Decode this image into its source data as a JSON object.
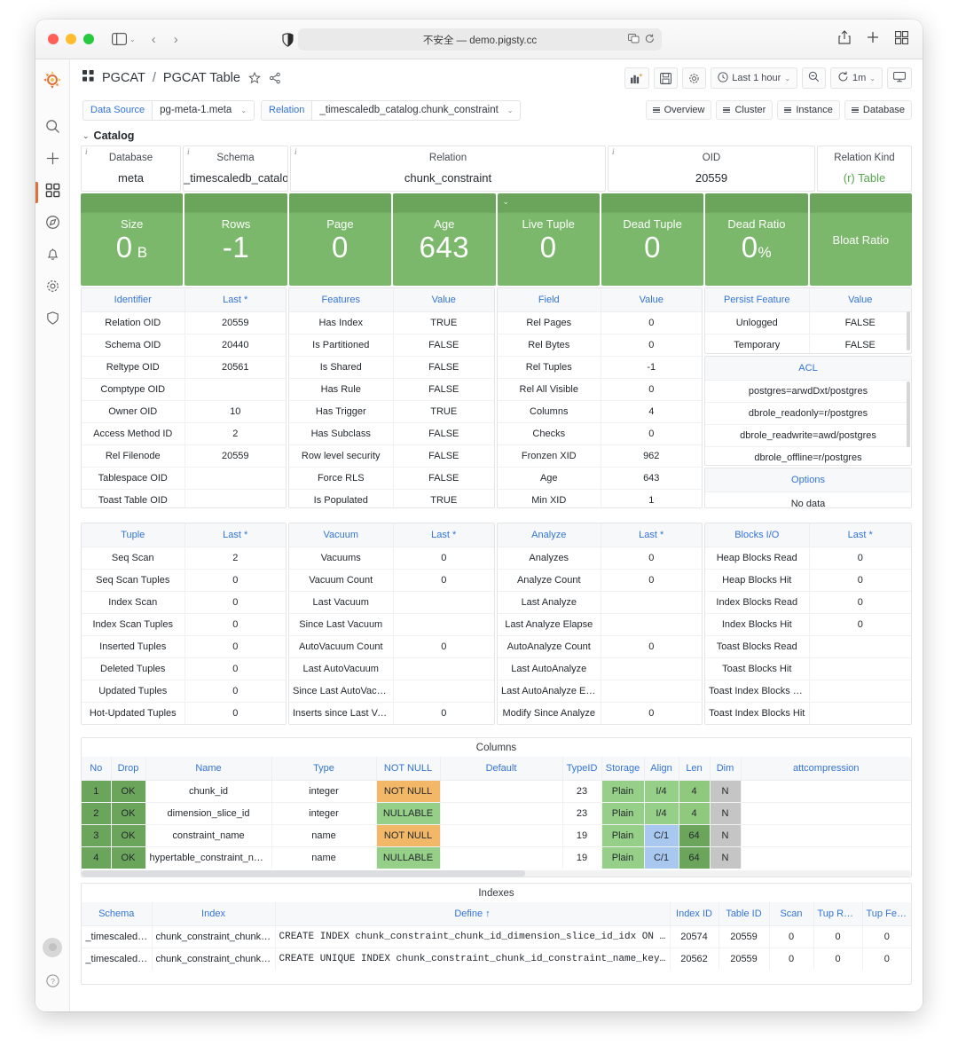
{
  "browser": {
    "url": "不安全 — demo.pigsty.cc",
    "icons": {
      "sidebar": "sidebar-toggle-icon",
      "back": "back-arrow-icon",
      "forward": "forward-arrow-icon",
      "shield": "privacy-shield-icon",
      "translate": "translate-icon",
      "reload": "reload-icon",
      "share": "share-icon",
      "newtab": "new-tab-icon",
      "tabgrid": "tab-overview-icon"
    }
  },
  "sidebar": {
    "logo": "grafana-logo-icon",
    "items": [
      {
        "name": "search",
        "icon": "search-icon",
        "active": false
      },
      {
        "name": "create",
        "icon": "plus-icon",
        "active": false
      },
      {
        "name": "dashboards",
        "icon": "grid-icon",
        "active": true
      },
      {
        "name": "explore",
        "icon": "compass-icon",
        "active": false
      },
      {
        "name": "alerting",
        "icon": "bell-icon",
        "active": false
      },
      {
        "name": "configuration",
        "icon": "gear-icon",
        "active": false
      },
      {
        "name": "server-admin",
        "icon": "shield-icon",
        "active": false
      }
    ],
    "bottom": [
      {
        "name": "user-profile",
        "icon": "avatar-icon"
      },
      {
        "name": "help",
        "icon": "question-circle-icon"
      }
    ]
  },
  "dashnav": {
    "grid_icon": "dashboard-grid-icon",
    "folder": "PGCAT",
    "separator": "/",
    "title": "PGCAT Table",
    "star_icon": "star-icon",
    "share_icon": "share-icon",
    "buttons": [
      {
        "name": "add-panel",
        "icon": "add-panel-icon",
        "label": ""
      },
      {
        "name": "save-dashboard",
        "icon": "save-icon",
        "label": ""
      },
      {
        "name": "dashboard-settings",
        "icon": "gear-icon",
        "label": ""
      }
    ],
    "time_picker": {
      "icon": "clock-icon",
      "label": "Last 1 hour",
      "caret": "⌄"
    },
    "zoom_out": {
      "icon": "zoom-out-icon"
    },
    "refresh": {
      "icon": "refresh-icon",
      "interval": "1m",
      "caret": "⌄"
    },
    "tv_mode": {
      "icon": "tv-icon"
    }
  },
  "variables": [
    {
      "label": "Data Source",
      "value": "pg-meta-1.meta",
      "caret": "⌄"
    },
    {
      "label": "Relation",
      "value": "_timescaledb_catalog.chunk_constraint",
      "caret": "⌄"
    }
  ],
  "links": [
    {
      "label": "Overview"
    },
    {
      "label": "Cluster"
    },
    {
      "label": "Instance"
    },
    {
      "label": "Database"
    }
  ],
  "row": {
    "chevron": "⌄",
    "title": "Catalog"
  },
  "info_stats": [
    {
      "title": "Database",
      "value": "meta",
      "info": "i",
      "green": false
    },
    {
      "title": "Schema",
      "value": "_timescaledb_catalog",
      "info": "i",
      "green": false
    },
    {
      "title": "Relation",
      "value": "chunk_constraint",
      "info": "i",
      "green": false
    },
    {
      "title": "OID",
      "value": "20559",
      "info": "i",
      "green": false
    },
    {
      "title": "Relation Kind",
      "value": "(r) Table",
      "info": "",
      "green": true
    }
  ],
  "big_stats": [
    {
      "title": "Size",
      "value": "0",
      "unit": " B"
    },
    {
      "title": "Rows",
      "value": "-1",
      "unit": ""
    },
    {
      "title": "Page",
      "value": "0",
      "unit": ""
    },
    {
      "title": "Age",
      "value": "643",
      "unit": ""
    },
    {
      "title": "Live Tuple",
      "value": "0",
      "unit": "",
      "caret": "⌄"
    },
    {
      "title": "Dead Tuple",
      "value": "0",
      "unit": ""
    },
    {
      "title": "Dead Ratio",
      "value": "0",
      "unit": "%"
    },
    {
      "title": "Bloat Ratio",
      "value": "",
      "unit": ""
    }
  ],
  "table_identifier": {
    "headers": [
      "Identifier",
      "Last *"
    ],
    "rows": [
      [
        "Relation OID",
        "20559"
      ],
      [
        "Schema OID",
        "20440"
      ],
      [
        "Reltype OID",
        "20561"
      ],
      [
        "Comptype OID",
        ""
      ],
      [
        "Owner OID",
        "10"
      ],
      [
        "Access Method ID",
        "2"
      ],
      [
        "Rel Filenode",
        "20559"
      ],
      [
        "Tablespace OID",
        ""
      ],
      [
        "Toast Table OID",
        ""
      ]
    ]
  },
  "table_features": {
    "headers": [
      "Features",
      "Value"
    ],
    "rows": [
      [
        "Has Index",
        "TRUE"
      ],
      [
        "Is Partitioned",
        "FALSE"
      ],
      [
        "Is Shared",
        "FALSE"
      ],
      [
        "Has Rule",
        "FALSE"
      ],
      [
        "Has Trigger",
        "TRUE"
      ],
      [
        "Has Subclass",
        "FALSE"
      ],
      [
        "Row level security",
        "FALSE"
      ],
      [
        "Force RLS",
        "FALSE"
      ],
      [
        "Is Populated",
        "TRUE"
      ]
    ]
  },
  "table_field": {
    "headers": [
      "Field",
      "Value"
    ],
    "rows": [
      [
        "Rel Pages",
        "0"
      ],
      [
        "Rel Bytes",
        "0"
      ],
      [
        "Rel Tuples",
        "-1"
      ],
      [
        "Rel All Visible",
        "0"
      ],
      [
        "Columns",
        "4"
      ],
      [
        "Checks",
        "0"
      ],
      [
        "Fronzen XID",
        "962"
      ],
      [
        "Age",
        "643"
      ],
      [
        "Min XID",
        "1"
      ]
    ]
  },
  "table_persist": {
    "headers": [
      "Persist Feature",
      "Value"
    ],
    "rows": [
      [
        "Unlogged",
        "FALSE"
      ],
      [
        "Temporary",
        "FALSE"
      ]
    ]
  },
  "table_acl": {
    "headers": [
      "ACL"
    ],
    "rows": [
      [
        "postgres=arwdDxt/postgres"
      ],
      [
        "dbrole_readonly=r/postgres"
      ],
      [
        "dbrole_readwrite=awd/postgres"
      ],
      [
        "dbrole_offline=r/postgres"
      ]
    ]
  },
  "table_options": {
    "headers": [
      "Options"
    ],
    "empty_text": "No data"
  },
  "table_tuple": {
    "headers": [
      "Tuple",
      "Last *"
    ],
    "rows": [
      [
        "Seq Scan",
        "2"
      ],
      [
        "Seq Scan Tuples",
        "0"
      ],
      [
        "Index Scan",
        "0"
      ],
      [
        "Index Scan Tuples",
        "0"
      ],
      [
        "Inserted Tuples",
        "0"
      ],
      [
        "Deleted Tuples",
        "0"
      ],
      [
        "Updated Tuples",
        "0"
      ],
      [
        "Hot-Updated Tuples",
        "0"
      ]
    ]
  },
  "table_vacuum": {
    "headers": [
      "Vacuum",
      "Last *"
    ],
    "rows": [
      [
        "Vacuums",
        "0"
      ],
      [
        "Vacuum Count",
        "0"
      ],
      [
        "Last Vacuum",
        ""
      ],
      [
        "Since Last Vacuum",
        ""
      ],
      [
        "AutoVacuum Count",
        "0"
      ],
      [
        "Last AutoVacuum",
        ""
      ],
      [
        "Since Last AutoVacuu…",
        ""
      ],
      [
        "Inserts since Last Vac…",
        "0"
      ]
    ]
  },
  "table_analyze": {
    "headers": [
      "Analyze",
      "Last *"
    ],
    "rows": [
      [
        "Analyzes",
        "0"
      ],
      [
        "Analyze Count",
        "0"
      ],
      [
        "Last Analyze",
        ""
      ],
      [
        "Last Analyze Elapse",
        ""
      ],
      [
        "AutoAnalyze Count",
        "0"
      ],
      [
        "Last AutoAnalyze",
        ""
      ],
      [
        "Last AutoAnalyze Ela…",
        ""
      ],
      [
        "Modify Since Analyze",
        "0"
      ]
    ]
  },
  "table_blocks": {
    "headers": [
      "Blocks I/O",
      "Last *"
    ],
    "rows": [
      [
        "Heap Blocks Read",
        "0"
      ],
      [
        "Heap Blocks Hit",
        "0"
      ],
      [
        "Index Blocks Read",
        "0"
      ],
      [
        "Index Blocks Hit",
        "0"
      ],
      [
        "Toast Blocks Read",
        ""
      ],
      [
        "Toast Blocks Hit",
        ""
      ],
      [
        "Toast Index Blocks Re…",
        ""
      ],
      [
        "Toast Index Blocks Hit",
        ""
      ]
    ]
  },
  "columns_panel": {
    "title": "Columns",
    "headers": [
      "No",
      "Drop",
      "Name",
      "Type",
      "NOT NULL",
      "Default",
      "TypeID",
      "Storage",
      "Align",
      "Len",
      "Dim",
      "attcompression"
    ],
    "rows": [
      {
        "no": "1",
        "drop": "OK",
        "name": "chunk_id",
        "type": "integer",
        "notnull": "NOT NULL",
        "default": "",
        "typeid": "23",
        "storage": "Plain",
        "align": "I/4",
        "len": "4",
        "dim": "N",
        "attcompression": ""
      },
      {
        "no": "2",
        "drop": "OK",
        "name": "dimension_slice_id",
        "type": "integer",
        "notnull": "NULLABLE",
        "default": "",
        "typeid": "23",
        "storage": "Plain",
        "align": "I/4",
        "len": "4",
        "dim": "N",
        "attcompression": ""
      },
      {
        "no": "3",
        "drop": "OK",
        "name": "constraint_name",
        "type": "name",
        "notnull": "NOT NULL",
        "default": "",
        "typeid": "19",
        "storage": "Plain",
        "align": "C/1",
        "len": "64",
        "dim": "N",
        "attcompression": ""
      },
      {
        "no": "4",
        "drop": "OK",
        "name": "hypertable_constraint_name",
        "type": "name",
        "notnull": "NULLABLE",
        "default": "",
        "typeid": "19",
        "storage": "Plain",
        "align": "C/1",
        "len": "64",
        "dim": "N",
        "attcompression": ""
      }
    ]
  },
  "indexes_panel": {
    "title": "Indexes",
    "headers": [
      "Schema",
      "Index",
      "Define ↑",
      "Index ID",
      "Table ID",
      "Scan",
      "Tup Read",
      "Tup Fetch"
    ],
    "rows": [
      {
        "schema": "_timescaled…",
        "index": "chunk_constraint_chunk_id_di…",
        "define": "CREATE INDEX chunk_constraint_chunk_id_dimension_slice_id_idx ON _time…",
        "index_id": "20574",
        "table_id": "20559",
        "scan": "0",
        "tup_read": "0",
        "tup_fetch": "0"
      },
      {
        "schema": "_timescaled…",
        "index": "chunk_constraint_chunk_id_co…",
        "define": "CREATE UNIQUE INDEX chunk_constraint_chunk_id_constraint_name_key ON _…",
        "index_id": "20562",
        "table_id": "20559",
        "scan": "0",
        "tup_read": "0",
        "tup_fetch": "0"
      }
    ]
  },
  "colors": {
    "accent_blue": "#3274d9",
    "green": "#73bf69",
    "orange": "#f2a25c",
    "panel_green": "#7cb86c",
    "panel_green_dark": "#6aa55b"
  }
}
